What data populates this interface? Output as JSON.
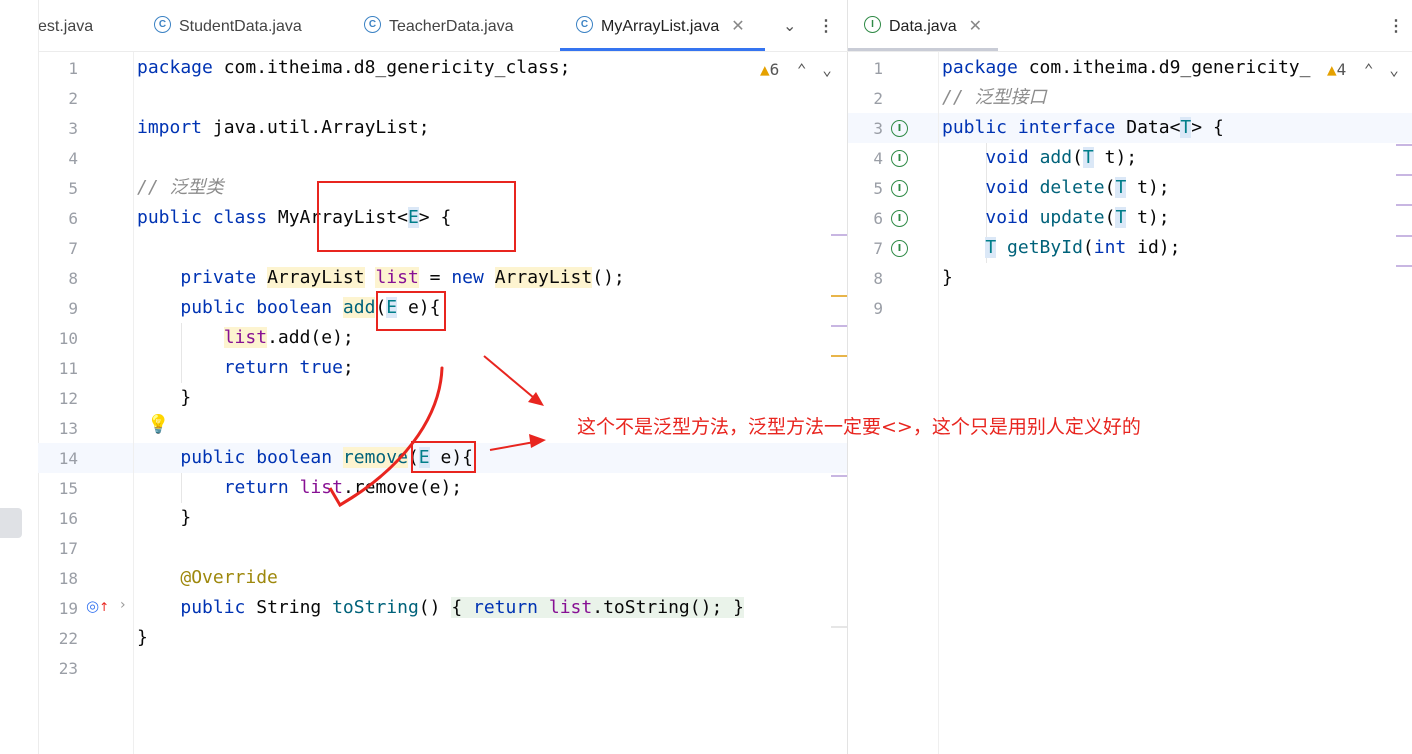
{
  "left_tabs": [
    {
      "label": "est.java"
    },
    {
      "label": "StudentData.java"
    },
    {
      "label": "TeacherData.java"
    },
    {
      "label": "MyArrayList.java"
    }
  ],
  "right_tabs": [
    {
      "label": "Data.java"
    }
  ],
  "left_editor": {
    "warning_count": "6",
    "line_numbers": [
      "1",
      "2",
      "3",
      "4",
      "5",
      "6",
      "7",
      "8",
      "9",
      "10",
      "11",
      "12",
      "13",
      "14",
      "15",
      "16",
      "17",
      "18",
      "19",
      "22",
      "23"
    ]
  },
  "right_editor": {
    "warning_count": "4",
    "line_numbers": [
      "1",
      "2",
      "3",
      "4",
      "5",
      "6",
      "7",
      "8",
      "9"
    ]
  },
  "annotation_text": "这个不是泛型方法，泛型方法一定要<>，这个只是用别人定义好的",
  "colors": {
    "accent": "#3574f0",
    "annotation": "#e8251f",
    "keyword": "#0033b3",
    "field": "#871094"
  },
  "icons": [
    "class-icon",
    "interface-icon",
    "warning-icon",
    "close-icon",
    "chevron-down-icon",
    "more-icon",
    "bulb-icon",
    "override-icon",
    "implemented-icon"
  ]
}
